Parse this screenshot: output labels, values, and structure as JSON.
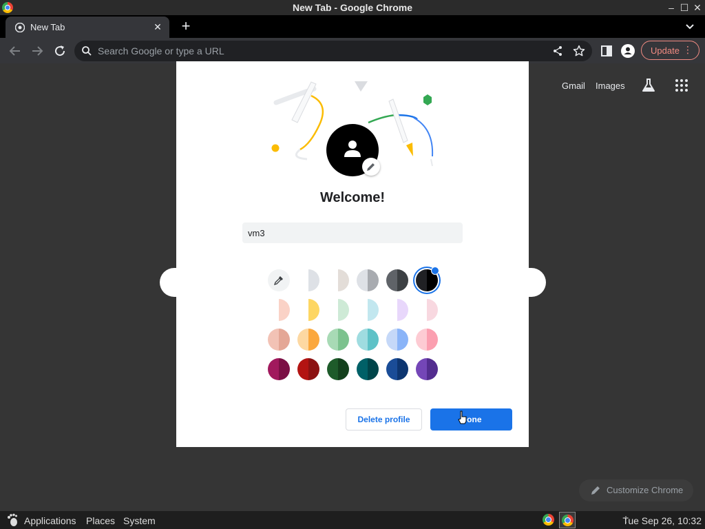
{
  "window": {
    "title": "New Tab - Google Chrome"
  },
  "tab": {
    "title": "New Tab"
  },
  "omnibox": {
    "placeholder": "Search Google or type a URL"
  },
  "toolbar": {
    "update_label": "Update"
  },
  "ntp": {
    "gmail": "Gmail",
    "images": "Images",
    "customize": "Customize Chrome"
  },
  "dialog": {
    "welcome": "Welcome!",
    "name_value": "vm3",
    "delete_label": "Delete profile",
    "done_label": "Done",
    "colors": [
      {
        "left": "#ffffff",
        "right": "#dee1e6",
        "selected": false
      },
      {
        "left": "#ffffff",
        "right": "#e3ddd8",
        "selected": false
      },
      {
        "left": "#dee1e6",
        "right": "#a8abb0",
        "selected": false
      },
      {
        "left": "#5f6368",
        "right": "#3c4043",
        "selected": false
      },
      {
        "left": "#202124",
        "right": "#000000",
        "selected": true
      },
      {
        "left": "#ffffff",
        "right": "#fad2c6",
        "selected": false
      },
      {
        "left": "#ffffff",
        "right": "#fdd663",
        "selected": false
      },
      {
        "left": "#ffffff",
        "right": "#ceead6",
        "selected": false
      },
      {
        "left": "#ffffff",
        "right": "#c2e7ef",
        "selected": false
      },
      {
        "left": "#ffffff",
        "right": "#e8d7fb",
        "selected": false
      },
      {
        "left": "#ffffff",
        "right": "#f8d8e0",
        "selected": false
      },
      {
        "left": "#f2c2b5",
        "right": "#e4a796",
        "selected": false
      },
      {
        "left": "#fdd8a2",
        "right": "#fba83e",
        "selected": false
      },
      {
        "left": "#a8dab5",
        "right": "#7cc28e",
        "selected": false
      },
      {
        "left": "#9fdce0",
        "right": "#5ec2c7",
        "selected": false
      },
      {
        "left": "#c5d8f8",
        "right": "#8ab4f8",
        "selected": false
      },
      {
        "left": "#fdcbd3",
        "right": "#fb9fb0",
        "selected": false
      },
      {
        "left": "#a1195d",
        "right": "#7b0f45",
        "selected": false
      },
      {
        "left": "#b31412",
        "right": "#8c1212",
        "selected": false
      },
      {
        "left": "#1e5b2a",
        "right": "#13401c",
        "selected": false
      },
      {
        "left": "#006067",
        "right": "#00454a",
        "selected": false
      },
      {
        "left": "#1a4c97",
        "right": "#0d3570",
        "selected": false
      },
      {
        "left": "#7446b7",
        "right": "#532d8f",
        "selected": false
      }
    ]
  },
  "taskbar": {
    "applications": "Applications",
    "places": "Places",
    "system": "System",
    "clock": "Tue Sep 26, 10:32"
  }
}
